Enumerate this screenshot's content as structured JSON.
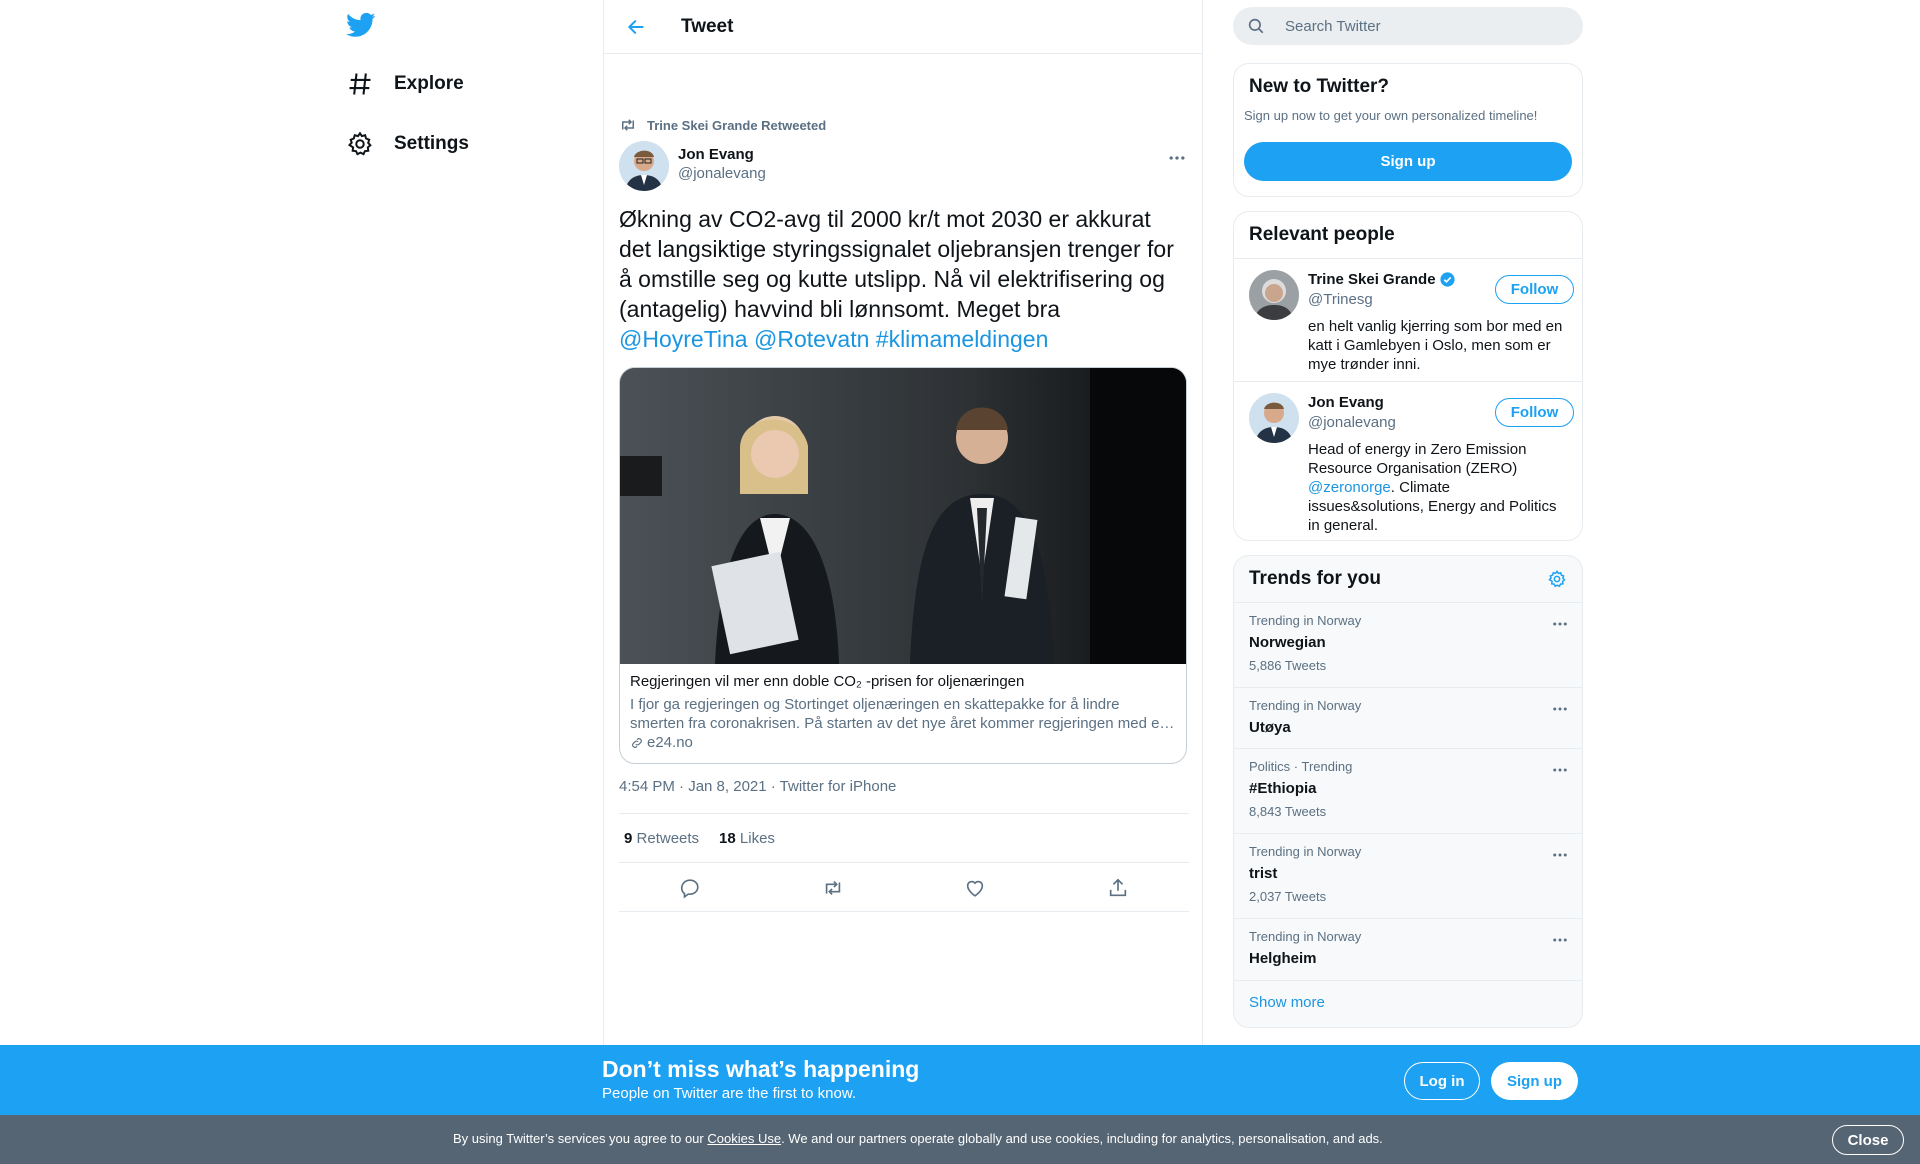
{
  "nav": {
    "explore_label": "Explore",
    "settings_label": "Settings"
  },
  "header": {
    "title": "Tweet"
  },
  "tweet": {
    "retweeted_by": "Trine Skei Grande Retweeted",
    "author_name": "Jon Evang",
    "author_handle": "@jonalevang",
    "text": "Økning av CO2-avg til 2000 kr/t mot 2030 er akkurat det langsiktige styringssignalet oljebransjen trenger for å omstille seg og kutte utslipp. Nå vil elektrifisering og (antagelig) havvind bli lønnsomt. Meget bra",
    "mentions": [
      "@HoyreTina",
      "@Rotevatn",
      "#klimameldingen"
    ],
    "card": {
      "title": "Regjeringen vil mer enn doble CO₂ -prisen for oljenæringen",
      "description": "I fjor ga regjeringen og Stortinget oljenæringen en skattepakke for å lindre smerten fra coronakrisen. På starten av det nye året kommer regjeringen med e…",
      "domain": "e24.no"
    },
    "timestamp": "4:54 PM · Jan 8, 2021",
    "source": "Twitter for iPhone",
    "retweets_count": "9",
    "retweets_label": "Retweets",
    "likes_count": "18",
    "likes_label": "Likes"
  },
  "search": {
    "placeholder": "Search Twitter"
  },
  "new_to_twitter": {
    "title": "New to Twitter?",
    "subtitle": "Sign up now to get your own personalized timeline!",
    "signup_label": "Sign up"
  },
  "relevant_people": {
    "title": "Relevant people",
    "people": [
      {
        "name": "Trine Skei Grande",
        "handle": "@Trinesg",
        "bio": "en helt vanlig kjerring som bor med en katt i Gamlebyen i Oslo, men som er mye trønder inni.",
        "follow_label": "Follow"
      },
      {
        "name": "Jon Evang",
        "handle": "@jonalevang",
        "bio_pre": "Head of energy in Zero Emission Resource Organisation (ZERO) ",
        "bio_link": "@zeronorge",
        "bio_post": ". Climate issues&solutions, Energy and Politics in general.",
        "follow_label": "Follow"
      }
    ]
  },
  "trends": {
    "title": "Trends for you",
    "items": [
      {
        "context": "Trending in Norway",
        "name": "Norwegian",
        "count": "5,886 Tweets"
      },
      {
        "context": "Trending in Norway",
        "name": "Utøya",
        "count": ""
      },
      {
        "context": "Politics · Trending",
        "name": "#Ethiopia",
        "count": "8,843 Tweets"
      },
      {
        "context": "Trending in Norway",
        "name": "trist",
        "count": "2,037 Tweets"
      },
      {
        "context": "Trending in Norway",
        "name": "Helgheim",
        "count": ""
      }
    ],
    "show_more": "Show more"
  },
  "banner": {
    "title": "Don’t miss what’s happening",
    "subtitle": "People on Twitter are the first to know.",
    "login_label": "Log in",
    "signup_label": "Sign up"
  },
  "cookie": {
    "text_pre": "By using Twitter’s services you agree to our ",
    "link": "Cookies Use",
    "text_post": ". We and our partners operate globally and use cookies, including for analytics, personalisation, and ads.",
    "close_label": "Close"
  },
  "colors": {
    "brand": "#1da1f2",
    "link": "#1b95e0",
    "muted": "#5b7083",
    "cookie_bg": "#566573"
  }
}
